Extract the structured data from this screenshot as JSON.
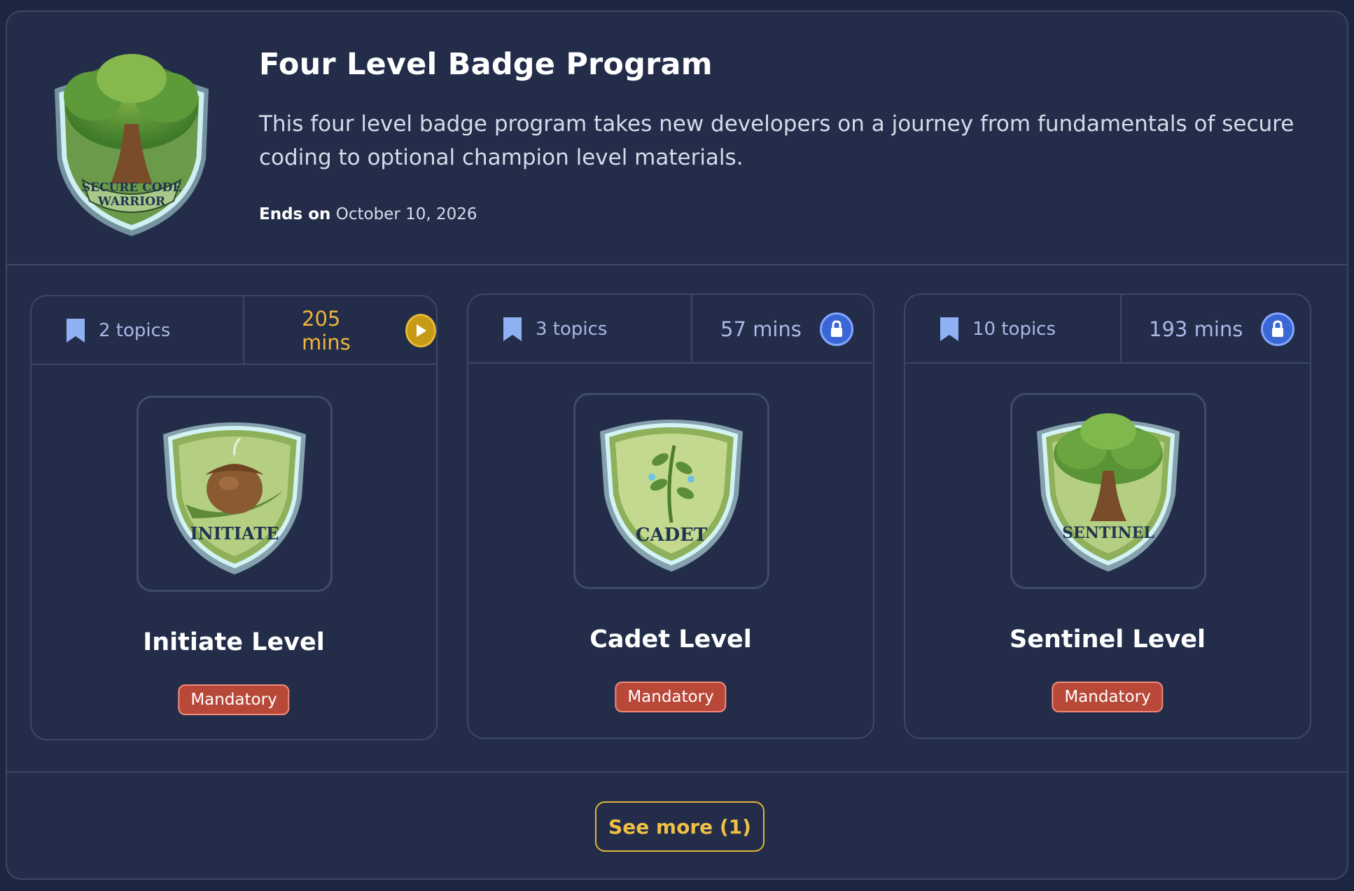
{
  "program": {
    "title": "Four Level Badge Program",
    "description": "This four level badge program takes new developers on a journey from fundamentals of secure coding to optional champion level materials.",
    "ends_label": "Ends on",
    "ends_date": "October 10, 2026",
    "badge_text_line1": "SECURE CODE",
    "badge_text_line2": "WARRIOR"
  },
  "levels": [
    {
      "topics": "2 topics",
      "mins": "205 mins",
      "status_icon": "play-icon",
      "badge_text": "INITIATE",
      "name": "Initiate Level",
      "tag": "Mandatory"
    },
    {
      "topics": "3 topics",
      "mins": "57 mins",
      "status_icon": "lock-icon",
      "badge_text": "CADET",
      "name": "Cadet Level",
      "tag": "Mandatory"
    },
    {
      "topics": "10 topics",
      "mins": "193 mins",
      "status_icon": "lock-icon",
      "badge_text": "SENTINEL",
      "name": "Sentinel Level",
      "tag": "Mandatory"
    }
  ],
  "footer": {
    "see_more": "See more (1)"
  },
  "colors": {
    "active_mins": "#f0b43c",
    "locked_mins": "#a9b8e6",
    "mandatory": "#b84838",
    "accent": "#e1b63a"
  }
}
